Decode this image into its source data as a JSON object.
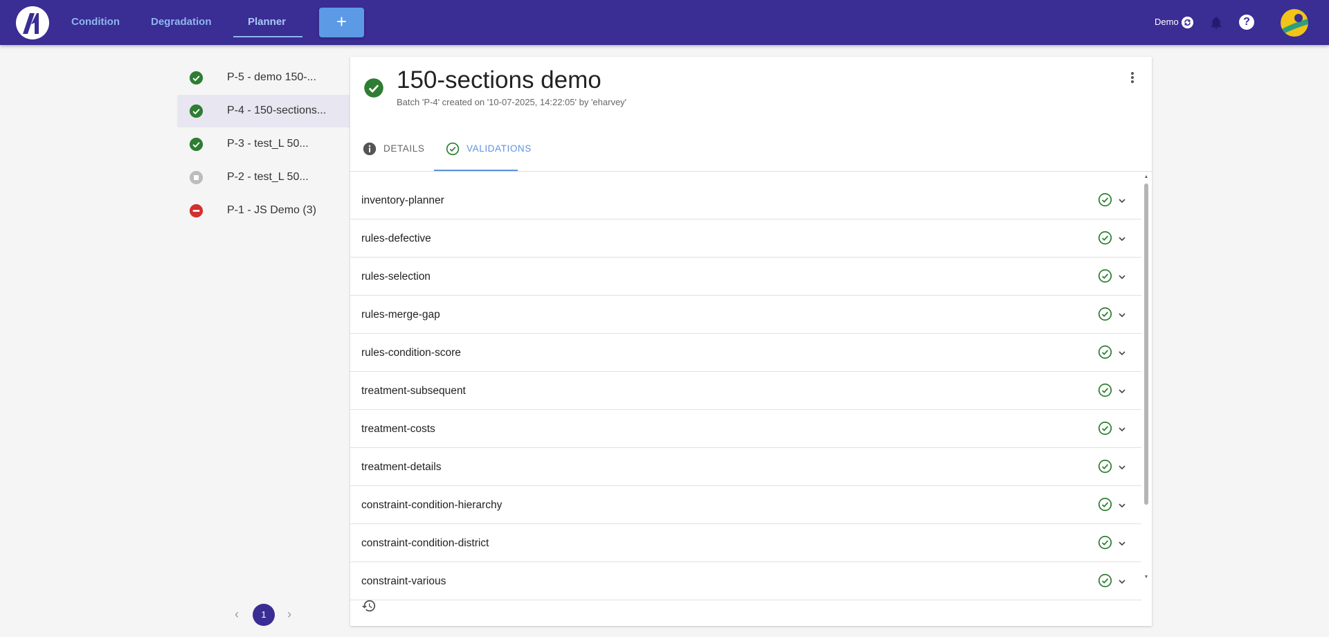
{
  "nav": {
    "tabs": [
      {
        "label": "Condition"
      },
      {
        "label": "Degradation"
      },
      {
        "label": "Planner"
      }
    ],
    "add_label": "+",
    "demo_label": "Demo",
    "help_label": "?",
    "colors": {
      "bar": "#3a2d94",
      "accent": "#5d9ae6"
    }
  },
  "sidebar": {
    "items": [
      {
        "label": "P-5 - demo 150-...",
        "status": "success"
      },
      {
        "label": "P-4 - 150-sections...",
        "status": "success"
      },
      {
        "label": "P-3 - test_L 50...",
        "status": "success"
      },
      {
        "label": "P-2 - test_L 50...",
        "status": "stopped"
      },
      {
        "label": "P-1 - JS Demo (3)",
        "status": "error"
      }
    ],
    "pagination": {
      "prev": "‹",
      "current": "1",
      "next": "›"
    }
  },
  "detail": {
    "title": "150-sections demo",
    "subtitle": "Batch 'P-4' created on '10-07-2025, 14:22:05' by 'eharvey'",
    "status": "success",
    "tabs": [
      {
        "label": "DETAILS",
        "icon": "info-icon"
      },
      {
        "label": "VALIDATIONS",
        "icon": "check-circle-icon"
      }
    ],
    "active_tab": "VALIDATIONS",
    "validations": [
      {
        "name": "inventory-planner"
      },
      {
        "name": "rules-defective"
      },
      {
        "name": "rules-selection"
      },
      {
        "name": "rules-merge-gap"
      },
      {
        "name": "rules-condition-score"
      },
      {
        "name": "treatment-subsequent"
      },
      {
        "name": "treatment-costs"
      },
      {
        "name": "treatment-details"
      },
      {
        "name": "constraint-condition-hierarchy"
      },
      {
        "name": "constraint-condition-district"
      },
      {
        "name": "constraint-various"
      }
    ]
  }
}
